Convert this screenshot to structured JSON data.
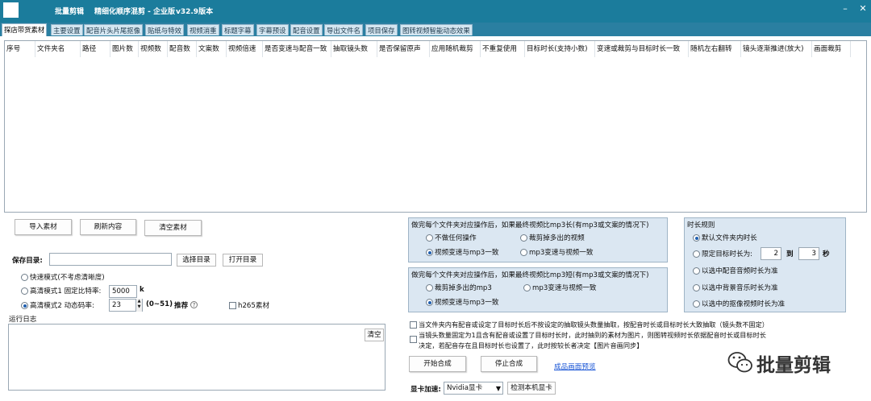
{
  "titlebar": {
    "app_name": "批量剪辑",
    "subtitle": "精细化顺序混剪 - 企业版",
    "version": "v32.9版本",
    "minimize_icon": "minimize-icon",
    "close_icon": "close-icon"
  },
  "tabs": [
    {
      "label": "探店带货素材",
      "active": true
    },
    {
      "label": "主要设置"
    },
    {
      "label": "配音片头片尾抠像"
    },
    {
      "label": "贴纸与特效"
    },
    {
      "label": "视频消重"
    },
    {
      "label": "标题字幕"
    },
    {
      "label": "字幕预设"
    },
    {
      "label": "配音设置"
    },
    {
      "label": "导出文件名"
    },
    {
      "label": "项目保存"
    },
    {
      "label": "图转视频智能动态效果"
    }
  ],
  "table": {
    "columns": [
      "序号",
      "文件夹名",
      "路径",
      "图片数",
      "视频数",
      "配音数",
      "文案数",
      "视频倍速",
      "是否变速与配音一致",
      "抽取镜头数",
      "是否保留原声",
      "应用随机裁剪",
      "不重复使用",
      "目标时长(支持小数)",
      "变速或裁剪与目标时长一致",
      "随机左右翻转",
      "镜头逐渐推进(放大)",
      "画面裁剪"
    ]
  },
  "material_buttons": {
    "import": "导入素材",
    "refresh": "刷新内容",
    "clear": "清空素材"
  },
  "save_dir": {
    "label": "保存目录:",
    "value": "",
    "choose_button": "选择目录",
    "open_button": "打开目录"
  },
  "modes": {
    "fast": "快速模式(不考虑清晰度)",
    "hd1": "高清模式1 固定比特率:",
    "hd1_value": "5000",
    "hd1_unit": "k",
    "hd2": "高清模式2 动态码率:",
    "hd2_value": "23",
    "hd2_range": "(0~51)",
    "hd2_recommend": "推荐",
    "h265": "h265素材",
    "selected": "hd2"
  },
  "log": {
    "label": "运行日志",
    "clear_button": "清空"
  },
  "panel_long": {
    "title": "做完每个文件夹对应操作后，如果最终视频比mp3长(有mp3或文案的情况下)",
    "options": [
      "不做任何操作",
      "裁剪掉多出的视频",
      "视频变速与mp3一致",
      "mp3变速与视频一致"
    ],
    "selected": 2
  },
  "panel_short": {
    "title": "做完每个文件夹对应操作后，如果最终视频比mp3短(有mp3或文案的情况下)",
    "options": [
      "裁剪掉多出的mp3",
      "mp3变速与视频一致",
      "视频变速与mp3一致"
    ],
    "selected": 2
  },
  "duration_rules": {
    "title": "时长规则",
    "options": [
      "默认文件夹内时长",
      "限定目标时长为:",
      "以选中配音音频时长为准",
      "以选中背景音乐时长为准",
      "以选中的抠像视频时长为准"
    ],
    "selected": 0,
    "min_value": "2",
    "to_label": "到",
    "max_value": "3",
    "unit": "秒"
  },
  "checks": {
    "rule1": "当文件夹内有配音或设定了目标时长后不按设定的抽取镜头数量抽取，按配音时长或目标时长大致抽取（镜头数不固定）",
    "rule2_line1": "当镜头数量固定为1且含有配音或设置了目标时长时，此时抽到的素材为图片，则图转视频时长依据配音时长或目标时长",
    "rule2_line2": "决定，若配音存在且目标时长也设置了，此时按较长者决定【图片音画同步】"
  },
  "actions": {
    "start": "开始合成",
    "stop": "停止合成",
    "preview_link": "成品画面预览"
  },
  "gpu": {
    "label": "显卡加速:",
    "value": "Nvidia显卡",
    "detect_button": "检测本机显卡"
  },
  "watermark": {
    "text": "批量剪辑",
    "icon": "wechat-icon"
  }
}
